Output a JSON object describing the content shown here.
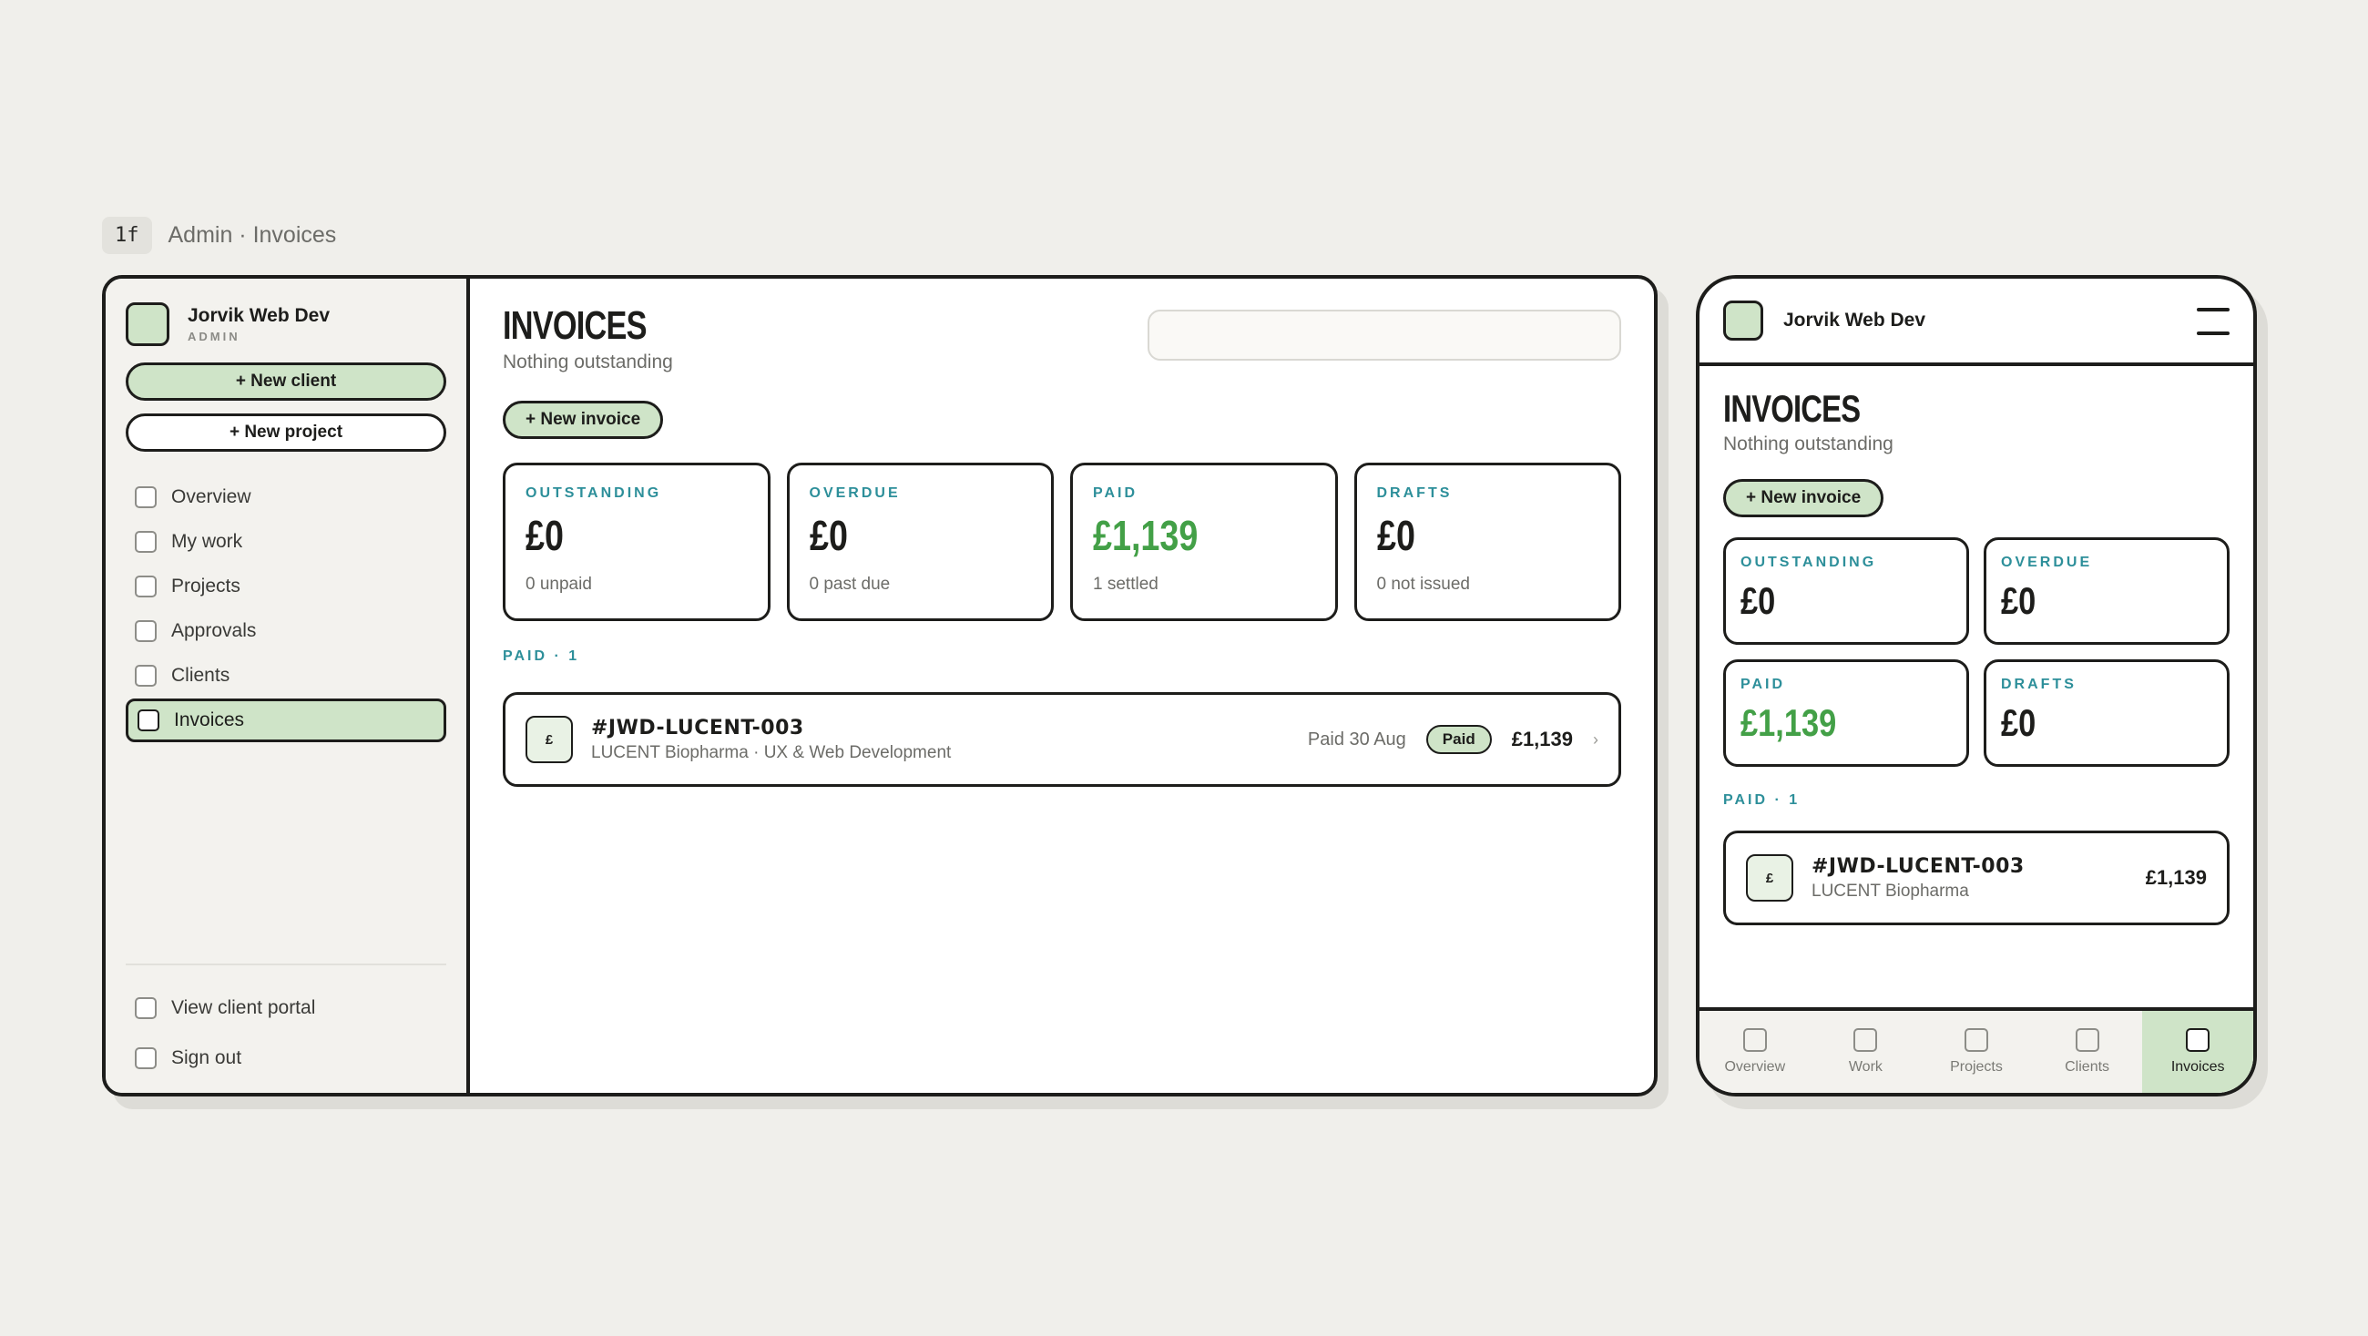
{
  "caption": {
    "tag": "1f",
    "title": "Admin · Invoices"
  },
  "brand": {
    "name": "Jorvik Web Dev",
    "role": "ADMIN"
  },
  "sidebar": {
    "new_client": "+ New client",
    "new_project": "+ New project",
    "items": [
      {
        "label": "Overview"
      },
      {
        "label": "My work"
      },
      {
        "label": "Projects"
      },
      {
        "label": "Approvals"
      },
      {
        "label": "Clients"
      },
      {
        "label": "Invoices"
      }
    ],
    "bottom": [
      {
        "label": "View client portal"
      },
      {
        "label": "Sign out"
      }
    ]
  },
  "page": {
    "title": "INVOICES",
    "subtitle": "Nothing outstanding",
    "new_invoice": "+ New invoice",
    "search_placeholder": ""
  },
  "stats": [
    {
      "label": "OUTSTANDING",
      "value": "£0",
      "note": "0 unpaid"
    },
    {
      "label": "OVERDUE",
      "value": "£0",
      "note": "0 past due"
    },
    {
      "label": "PAID",
      "value": "£1,139",
      "note": "1 settled"
    },
    {
      "label": "DRAFTS",
      "value": "£0",
      "note": "0 not issued"
    }
  ],
  "section": {
    "label": "PAID · 1"
  },
  "invoice": {
    "icon": "£",
    "id": "#JWD-LUCENT-003",
    "client": "LUCENT Biopharma · UX & Web Development",
    "client_short": "LUCENT Biopharma",
    "date": "Paid 30 Aug",
    "status": "Paid",
    "amount": "£1,139",
    "chevron": "›"
  },
  "mobile_tabs": [
    {
      "label": "Overview"
    },
    {
      "label": "Work"
    },
    {
      "label": "Projects"
    },
    {
      "label": "Clients"
    },
    {
      "label": "Invoices"
    }
  ],
  "colors": {
    "accent_green": "#cfe4c8",
    "paid_green": "#43a047",
    "label_teal": "#2d8f9a",
    "ink": "#1d1d1b"
  }
}
